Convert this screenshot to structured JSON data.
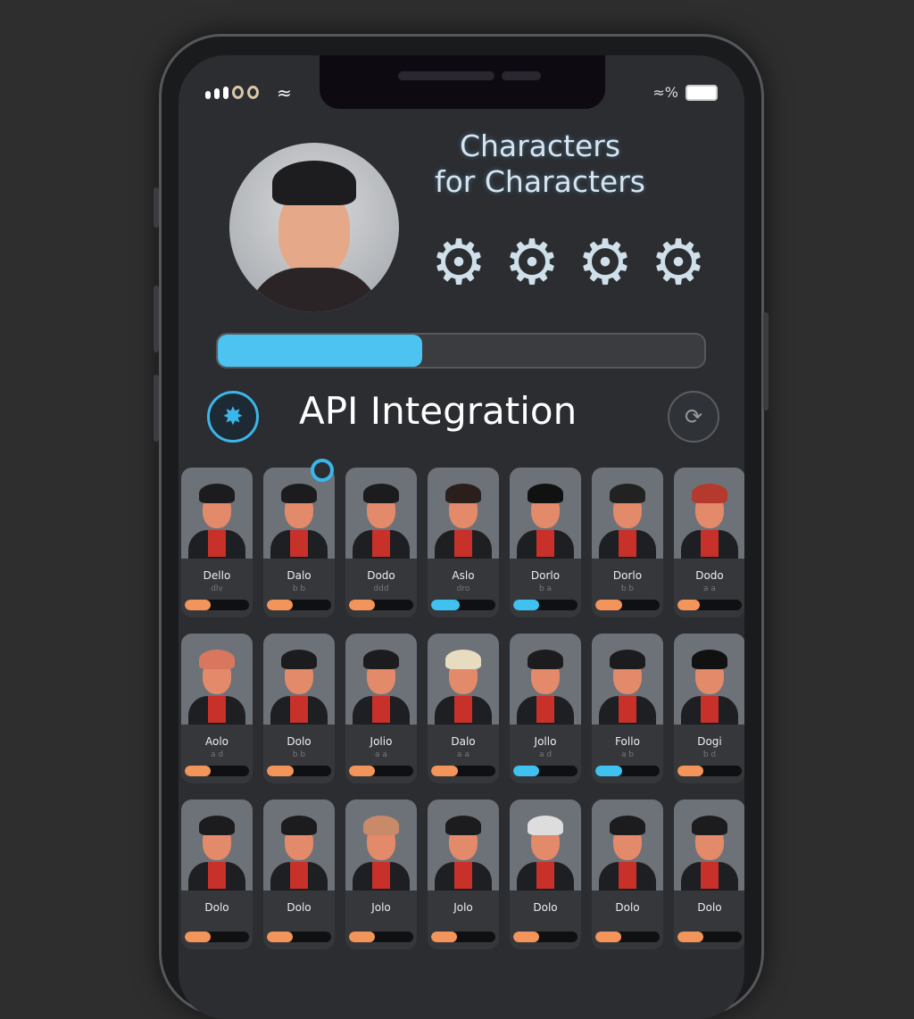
{
  "status_bar": {
    "icons": [
      "signal-icon",
      "wifi-icon",
      "battery-icon"
    ]
  },
  "header": {
    "title_line1": "Characters",
    "title_line2": "for Characters",
    "gears": [
      "gear-icon",
      "gear-icon",
      "gear-icon",
      "gear-icon"
    ]
  },
  "progress": {
    "percent": 42,
    "color": "#4cc3f1"
  },
  "api": {
    "title": "API Integration",
    "icon": "network-icon",
    "action_icon": "refresh-icon"
  },
  "colors": {
    "orange": "#f3955a",
    "blue": "#3fc2ef"
  },
  "characters": [
    {
      "name": "Dello",
      "sub": "dlv",
      "bar": "orange",
      "progress": 40
    },
    {
      "name": "Dalo",
      "sub": "b b",
      "bar": "orange",
      "progress": 40
    },
    {
      "name": "Dodo",
      "sub": "ddd",
      "bar": "orange",
      "progress": 40
    },
    {
      "name": "Aslo",
      "sub": "dro",
      "bar": "blue",
      "progress": 45
    },
    {
      "name": "Dorlo",
      "sub": "b a",
      "bar": "blue",
      "progress": 40
    },
    {
      "name": "Dorlo",
      "sub": "b b",
      "bar": "orange",
      "progress": 42
    },
    {
      "name": "Dodo",
      "sub": "a a",
      "bar": "orange",
      "progress": 35
    },
    {
      "name": "Aolo",
      "sub": "a d",
      "bar": "orange",
      "progress": 40
    },
    {
      "name": "Dolo",
      "sub": "b b",
      "bar": "orange",
      "progress": 42
    },
    {
      "name": "Jolio",
      "sub": "a a",
      "bar": "orange",
      "progress": 40
    },
    {
      "name": "Dalo",
      "sub": "a a",
      "bar": "orange",
      "progress": 42
    },
    {
      "name": "Jollo",
      "sub": "a d",
      "bar": "blue",
      "progress": 40
    },
    {
      "name": "Follo",
      "sub": "a b",
      "bar": "blue",
      "progress": 42
    },
    {
      "name": "Dogi",
      "sub": "b d",
      "bar": "orange",
      "progress": 40
    },
    {
      "name": "Dolo",
      "sub": "",
      "bar": "orange",
      "progress": 40
    },
    {
      "name": "Dolo",
      "sub": "",
      "bar": "orange",
      "progress": 40
    },
    {
      "name": "Jolo",
      "sub": "",
      "bar": "orange",
      "progress": 40
    },
    {
      "name": "Jolo",
      "sub": "",
      "bar": "orange",
      "progress": 40
    },
    {
      "name": "Dolo",
      "sub": "",
      "bar": "orange",
      "progress": 40
    },
    {
      "name": "Dolo",
      "sub": "",
      "bar": "orange",
      "progress": 40
    },
    {
      "name": "Dolo",
      "sub": "",
      "bar": "orange",
      "progress": 40
    }
  ]
}
